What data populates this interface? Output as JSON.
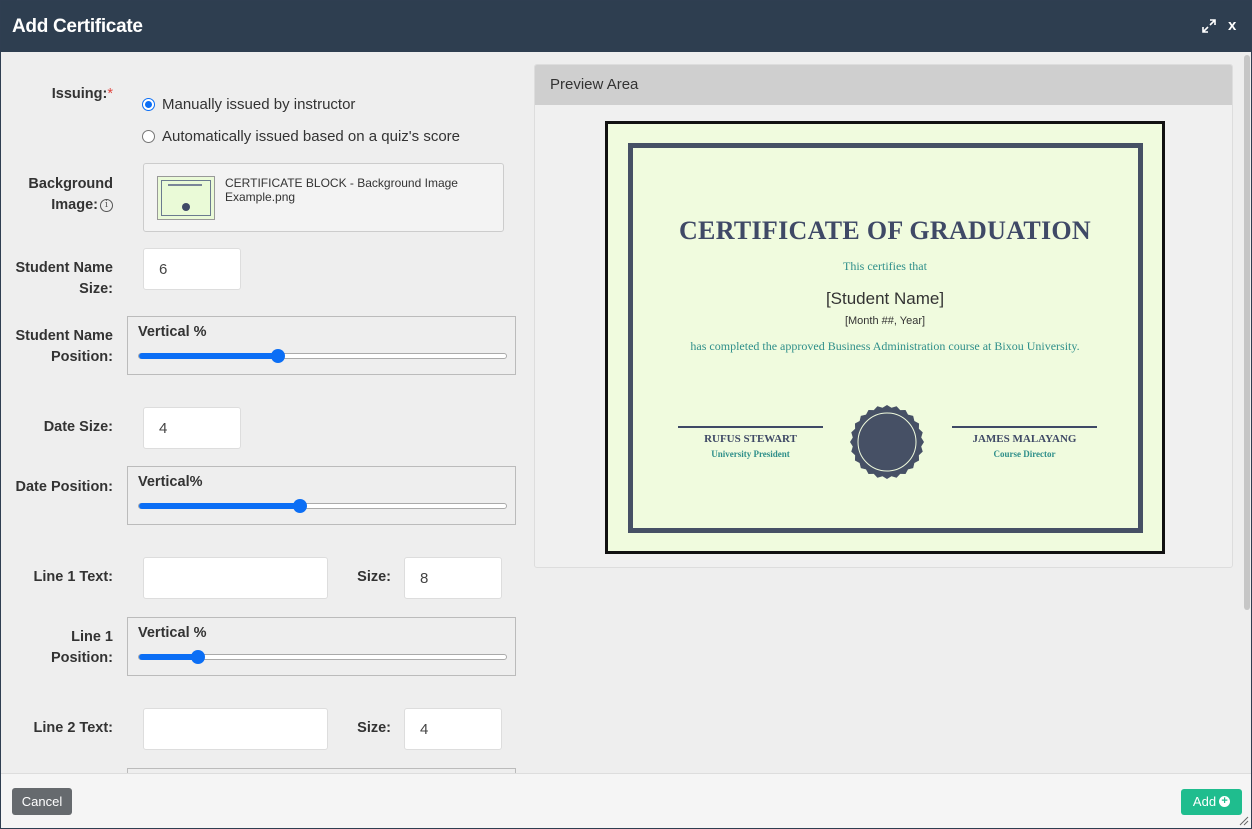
{
  "dialog": {
    "title": "Add Certificate",
    "close_label": "x"
  },
  "form": {
    "issuing_label": "Issuing:",
    "required_mark": "*",
    "issuing_options": [
      {
        "label": "Manually issued by instructor",
        "selected": true
      },
      {
        "label": "Automatically issued based on a quiz's score",
        "selected": false
      }
    ],
    "background_label_line1": "Background",
    "background_label_line2": "Image:",
    "background_info": "i",
    "background_filename": "CERTIFICATE BLOCK - Background Image Example.png",
    "student_name_size_label_line1": "Student Name",
    "student_name_size_label_line2": "Size:",
    "student_name_size_value": "6",
    "student_name_position_label_line1": "Student Name",
    "student_name_position_label_line2": "Position:",
    "student_name_position_title": "Vertical %",
    "student_name_position_value": 0.38,
    "date_size_label": "Date Size:",
    "date_size_value": "4",
    "date_position_label": "Date Position:",
    "date_position_title": "Vertical%",
    "date_position_value": 0.44,
    "line1_text_label": "Line 1 Text:",
    "line1_text_value": "",
    "line1_size_label": "Size:",
    "line1_size_value": "8",
    "line1_position_label_line1": "Line 1",
    "line1_position_label_line2": "Position:",
    "line1_position_title": "Vertical %",
    "line1_position_value": 0.16,
    "line2_text_label": "Line 2 Text:",
    "line2_text_value": "",
    "line2_size_label": "Size:",
    "line2_size_value": "4"
  },
  "preview": {
    "title": "Preview Area",
    "certificate": {
      "heading": "CERTIFICATE OF GRADUATION",
      "certifies": "This certifies that",
      "student_name": "[Student Name]",
      "date": "[Month ##, Year]",
      "completion": "has completed the approved Business Administration course at Bixou University.",
      "signer_left_name": "RUFUS STEWART",
      "signer_left_role": "University President",
      "signer_right_name": "JAMES MALAYANG",
      "signer_right_role": "Course Director"
    }
  },
  "footer": {
    "cancel_label": "Cancel",
    "add_label": "Add"
  },
  "colors": {
    "header_bg": "#2e3e50",
    "accent": "#0b6ef5",
    "add_button": "#1fbd8e",
    "certificate_bg": "#f0fbde",
    "certificate_ink": "#3f4966",
    "certificate_teal": "#2f8f8a"
  },
  "icons": {
    "expand": "expand-icon",
    "info": "info-icon",
    "add": "plus-circle-icon",
    "seal": "seal-icon"
  }
}
